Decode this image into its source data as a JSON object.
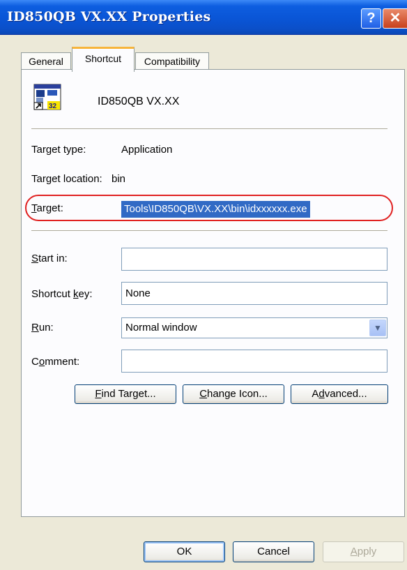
{
  "window": {
    "title": "ID850QB VX.XX Properties",
    "help_glyph": "?",
    "close_glyph": "✕"
  },
  "tabs": [
    {
      "label": "General"
    },
    {
      "label": "Shortcut"
    },
    {
      "label": "Compatibility"
    }
  ],
  "shortcut": {
    "icon": "application-shortcut-icon",
    "icon_badge": "32",
    "name": "ID850QB VX.XX",
    "target_type_label": "Target type:",
    "target_type_value": "Application",
    "target_location_label": "Target location:",
    "target_location_value": "bin",
    "target_label_key": "T",
    "target_label_rest": "arget:",
    "target_value": "Tools\\ID850QB\\VX.XX\\bin\\idxxxxxx.exe",
    "start_in_label_key": "S",
    "start_in_label_rest": "tart in:",
    "start_in_value": "",
    "shortcut_key_label_pre": "Shortcut ",
    "shortcut_key_label_key": "k",
    "shortcut_key_label_rest": "ey:",
    "shortcut_key_value": "None",
    "run_label_key": "R",
    "run_label_rest": "un:",
    "run_value": "Normal window",
    "comment_label_pre": "C",
    "comment_label_key": "o",
    "comment_label_rest": "mment:",
    "comment_value": ""
  },
  "actions": {
    "find_target_key": "F",
    "find_target_rest": "ind Target...",
    "change_icon_key": "C",
    "change_icon_rest": "hange Icon...",
    "advanced_pre": "A",
    "advanced_key": "d",
    "advanced_rest": "vanced..."
  },
  "footer": {
    "ok": "OK",
    "cancel": "Cancel",
    "apply_key": "A",
    "apply_rest": "pply"
  },
  "colors": {
    "titlebar": "#0a55d6",
    "selection": "#316ac5",
    "annotation": "#e02020",
    "tab_highlight": "#f7b43a"
  }
}
